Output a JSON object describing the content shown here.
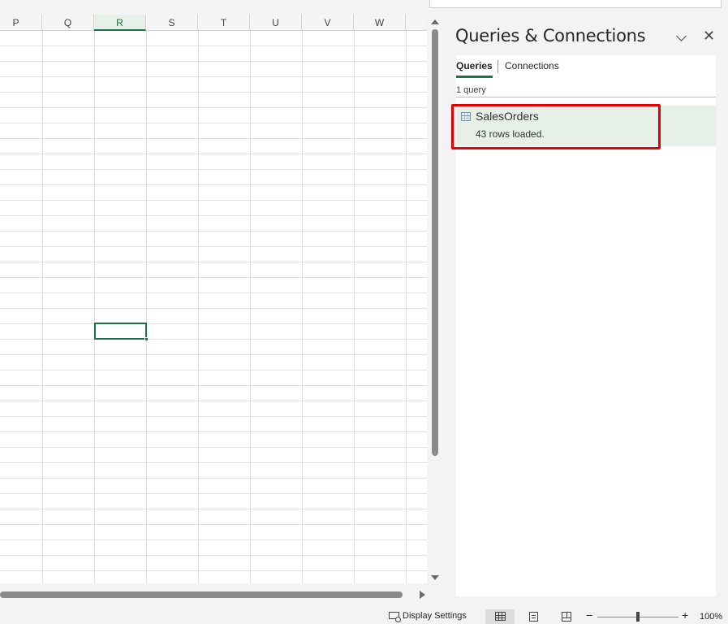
{
  "sheet": {
    "columns": [
      "P",
      "Q",
      "R",
      "S",
      "T",
      "U",
      "V",
      "W"
    ],
    "selected_column": "R"
  },
  "pane": {
    "title": "Queries & Connections",
    "collapse_icon": "chevron-down-icon",
    "close_icon": "close-icon",
    "close_glyph": "✕",
    "tabs": [
      {
        "label": "Queries",
        "active": true
      },
      {
        "label": "Connections",
        "active": false
      }
    ],
    "query_count": "1 query",
    "queries": [
      {
        "name": "SalesOrders",
        "status": "43 rows loaded.",
        "icon": "table-icon"
      }
    ]
  },
  "statusbar": {
    "display_settings": "Display Settings",
    "zoom_minus": "−",
    "zoom_plus": "+",
    "zoom_level": "100%"
  },
  "colors": {
    "accent": "#1e7145",
    "highlight": "#e30000",
    "selected_item_bg": "#e6efe8"
  }
}
